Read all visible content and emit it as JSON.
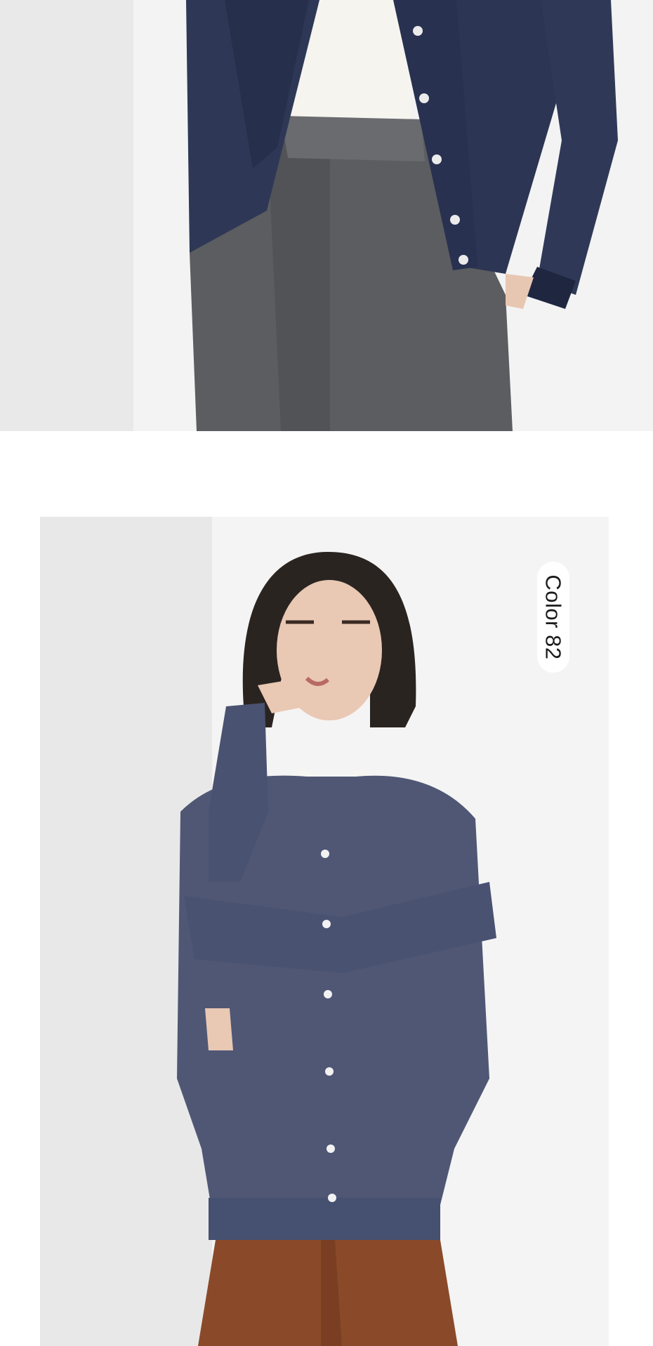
{
  "product_gallery": {
    "top_photo": {
      "description_icon": "model-photo-navy-cardigan-gray-trousers"
    },
    "bottom_photo": {
      "description_icon": "model-photo-blue-gray-cardigan-brown-trousers"
    },
    "color_label": "Color 82"
  },
  "colors": {
    "background": "#ffffff",
    "navy_cardigan": "#2c3553",
    "gray_trousers": "#5e5f61",
    "blue_gray_cardigan": "#4f5775",
    "brown_trousers": "#8a4a2a",
    "wall": "#eeeeee"
  }
}
